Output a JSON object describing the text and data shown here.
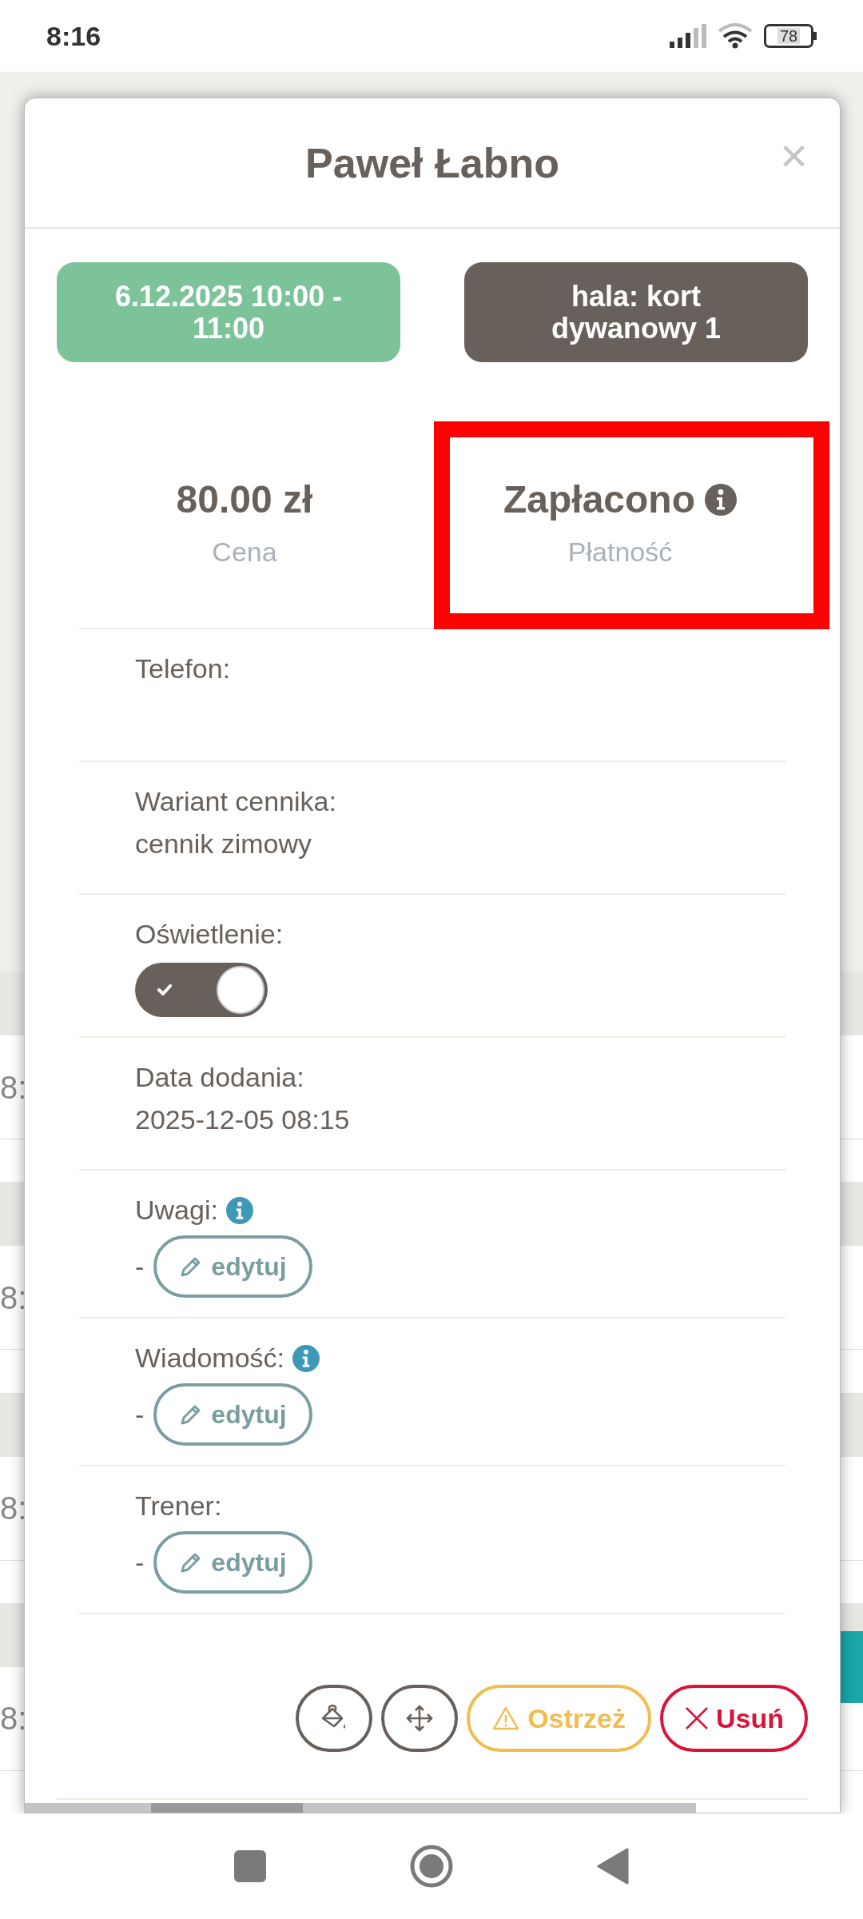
{
  "status_bar": {
    "time": "8:16",
    "battery": "78"
  },
  "background": {
    "rows": [
      {
        "left": "8:"
      },
      {
        "left": "8:"
      },
      {
        "left": "8:"
      },
      {
        "left": "8:"
      }
    ]
  },
  "modal": {
    "title": "Paweł Łabno",
    "close": "×",
    "chips": [
      {
        "text": "6.12.2025 10:00 - 11:00",
        "color": "#7cc39a"
      },
      {
        "text": "hala: kort dywanowy 1",
        "color": "#68615b"
      }
    ],
    "stats": [
      {
        "value": "80.00 zł",
        "label": "Cena",
        "info": false,
        "highlighted": false
      },
      {
        "value": "Zapłacono",
        "label": "Płatność",
        "info": true,
        "highlighted": true
      }
    ],
    "fields": [
      {
        "kind": "text",
        "label": "Telefon:"
      },
      {
        "kind": "text",
        "label": "Wariant cennika:",
        "value": "cennik zimowy"
      },
      {
        "kind": "toggle",
        "label": "Oświetlenie:",
        "on": true
      },
      {
        "kind": "text",
        "label": "Data dodania:",
        "value": "2025-12-05 08:15"
      },
      {
        "kind": "edit",
        "label": "Uwagi:",
        "info": true,
        "value": "-",
        "button": "edytuj"
      },
      {
        "kind": "edit",
        "label": "Wiadomość:",
        "info": true,
        "value": "-",
        "button": "edytuj"
      },
      {
        "kind": "edit",
        "label": "Trener:",
        "info": false,
        "value": "-",
        "button": "edytuj"
      }
    ],
    "actions": [
      {
        "kind": "paint"
      },
      {
        "kind": "move"
      },
      {
        "kind": "warn",
        "label": "Ostrzeż"
      },
      {
        "kind": "danger",
        "label": "Usuń"
      }
    ]
  }
}
